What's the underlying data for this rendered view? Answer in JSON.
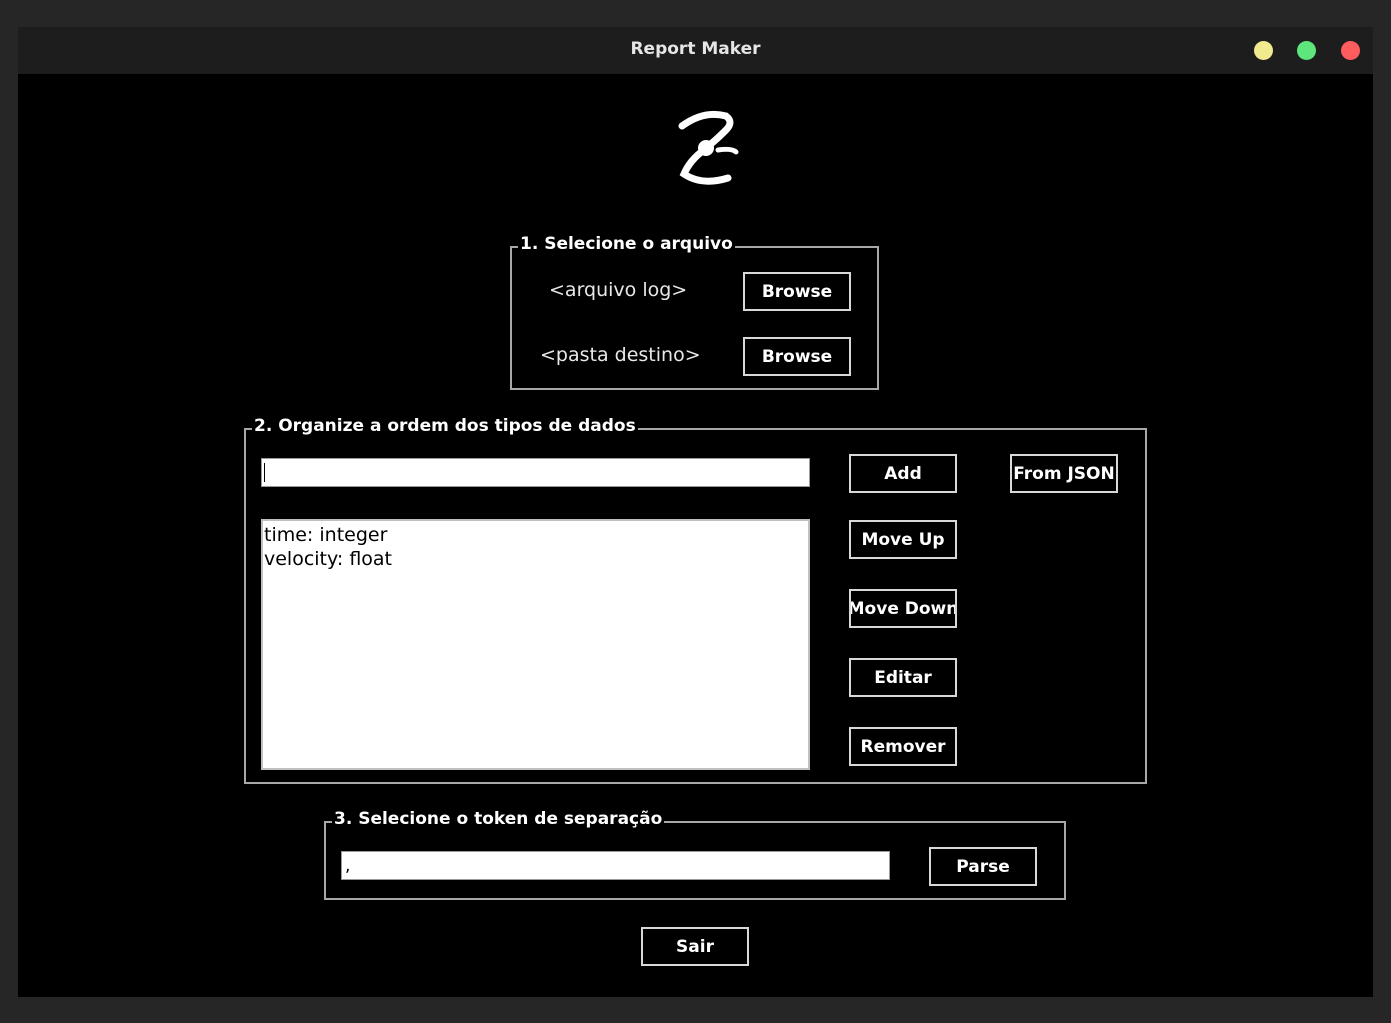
{
  "window": {
    "title": "Report Maker"
  },
  "section1": {
    "legend": "1. Selecione o arquivo",
    "log_label": "<arquivo log>",
    "dest_label": "<pasta destino>",
    "browse_label": "Browse"
  },
  "section2": {
    "legend": "2. Organize a ordem dos tipos de dados",
    "input_value": "",
    "items": [
      "time: integer",
      "velocity: float"
    ],
    "add_label": "Add",
    "from_json_label": "From JSON",
    "move_up_label": "Move Up",
    "move_down_label": "Move Down",
    "edit_label": "Editar",
    "remove_label": "Remover"
  },
  "section3": {
    "legend": "3. Selecione o token de separação",
    "token_value": ",",
    "parse_label": "Parse"
  },
  "exit_label": "Sair",
  "colors": {
    "yellow_dot": "#f1ea8f",
    "green_dot": "#5ee67d",
    "red_dot": "#ff5d5d"
  }
}
